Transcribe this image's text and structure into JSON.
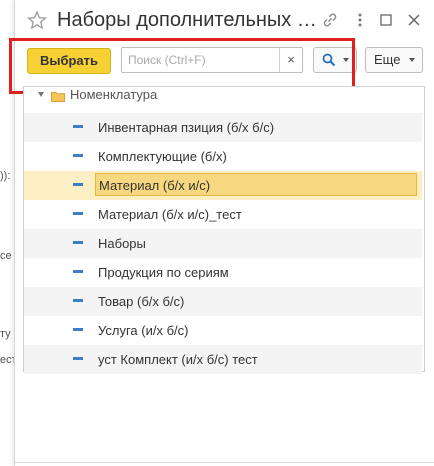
{
  "background": {
    "fragments": [
      ")):",
      "се",
      "ту",
      "ест"
    ]
  },
  "window": {
    "title": "Наборы дополнительных …",
    "toolbar": {
      "select_label": "Выбрать",
      "search_placeholder": "Поиск (Ctrl+F)",
      "clear_glyph": "×",
      "more_label": "Еще"
    },
    "tree": {
      "root_label": "Номенклатура",
      "items": [
        {
          "label": "Инвентарная пзиция (б/х б/с)"
        },
        {
          "label": "Комплектующие (б/х)"
        },
        {
          "label": "Материал (б/х и/с)",
          "selected": true
        },
        {
          "label": "Материал (б/х и/с)_тест"
        },
        {
          "label": "Наборы"
        },
        {
          "label": "Продукция по сериям"
        },
        {
          "label": "Товар (б/х б/с)"
        },
        {
          "label": "Услуга (и/х б/с)"
        },
        {
          "label": "уст Комплект (и/х б/с) тест"
        }
      ]
    }
  },
  "icons": {
    "favorite": "star-icon",
    "link": "link-icon",
    "maximize": "maximize-icon",
    "close": "close-icon",
    "search": "magnifier-icon",
    "folder": "folder-icon"
  },
  "colors": {
    "accent_button": "#f7d133",
    "selection_row": "#fcefc4",
    "selection_cell": "#f7d880",
    "annotation_box": "#e02020",
    "item_marker": "#3d7ec6"
  }
}
